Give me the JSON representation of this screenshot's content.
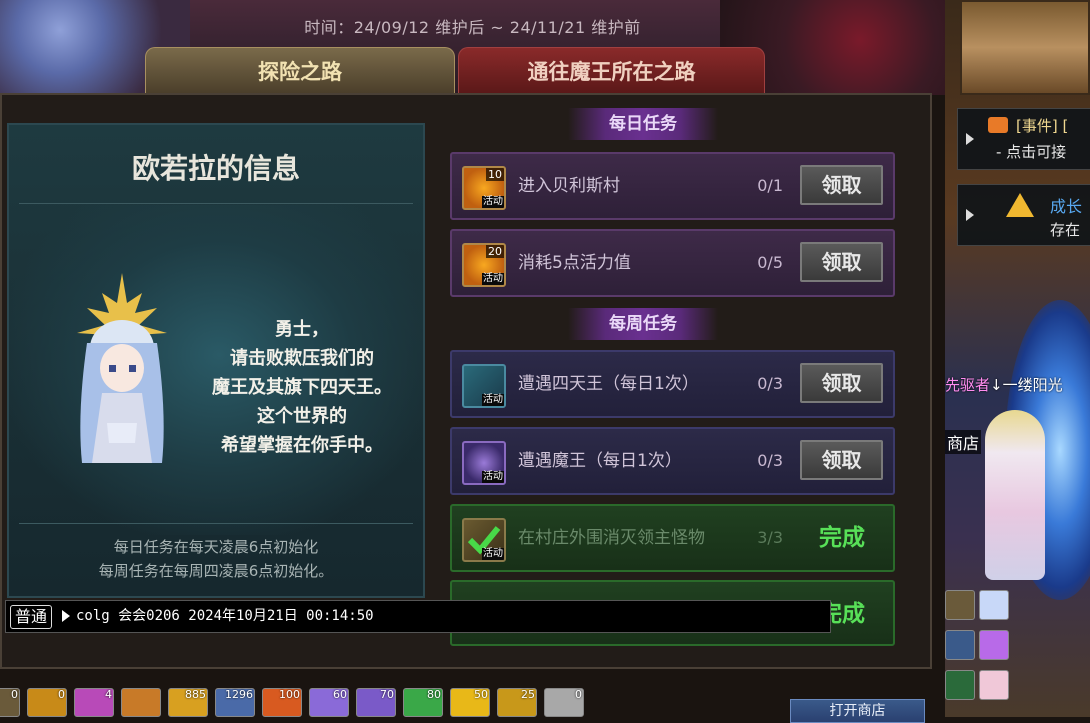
{
  "banner": {
    "time_text": "时间：24/09/12 维护后 ~ 24/11/21 维护前"
  },
  "tabs": [
    {
      "label": "探险之路",
      "active": true
    },
    {
      "label": "通往魔王所在之路",
      "active": false
    }
  ],
  "info": {
    "title": "欧若拉的信息",
    "speech": [
      "勇士，",
      "请击败欺压我们的",
      "魔王及其旗下四天王。",
      "这个世界的",
      "希望掌握在你手中。"
    ],
    "reset_notes": [
      "每日任务在每天凌晨6点初始化",
      "每周任务在每周四凌晨6点初始化。"
    ]
  },
  "daily": {
    "header": "每日任务",
    "quests": [
      {
        "name": "进入贝利斯村",
        "progress": "0/1",
        "button": "领取",
        "icon": "activity-10-icon",
        "badge": "10",
        "tag": "活动"
      },
      {
        "name": "消耗5点活力值",
        "progress": "0/5",
        "button": "领取",
        "icon": "activity-20-icon",
        "badge": "20",
        "tag": "活动"
      }
    ]
  },
  "weekly": {
    "header": "每周任务",
    "quests": [
      {
        "name": "遭遇四天王（每日1次）",
        "progress": "0/3",
        "button": "领取",
        "icon": "sword-activity-icon",
        "tag": "活动"
      },
      {
        "name": "遭遇魔王（每日1次）",
        "progress": "0/3",
        "button": "领取",
        "icon": "orb-activity-icon",
        "tag": "活动"
      },
      {
        "name": "在村庄外围消灭领主怪物",
        "progress": "3/3",
        "status": "完成",
        "icon": "checkmark-activity-icon",
        "tag": "活动"
      },
      {
        "status": "完成"
      }
    ]
  },
  "chat": {
    "channel": "普通",
    "text": "colg 会会0206 2024年10月21日 00:14:50"
  },
  "itembar": {
    "counts": [
      "0",
      "0",
      "4",
      "",
      "885",
      "1296",
      "100",
      "60",
      "70",
      "80",
      "50",
      "25",
      "0"
    ]
  },
  "shop_button": "打开商店",
  "right_game": {
    "event_line1": "[事件] [",
    "event_line2": "- 点击可接",
    "growth_line1": "成长",
    "growth_line2": "存在",
    "nameplate_left": "先驱者",
    "nameplate_right": "↓一缕阳光",
    "shop_label": "商店"
  },
  "colors": {
    "done_green": "#58e058",
    "daily_purple": "#5a2a7a",
    "tab_active": "#7a6a4a",
    "tab_inactive": "#8a2a2a"
  }
}
